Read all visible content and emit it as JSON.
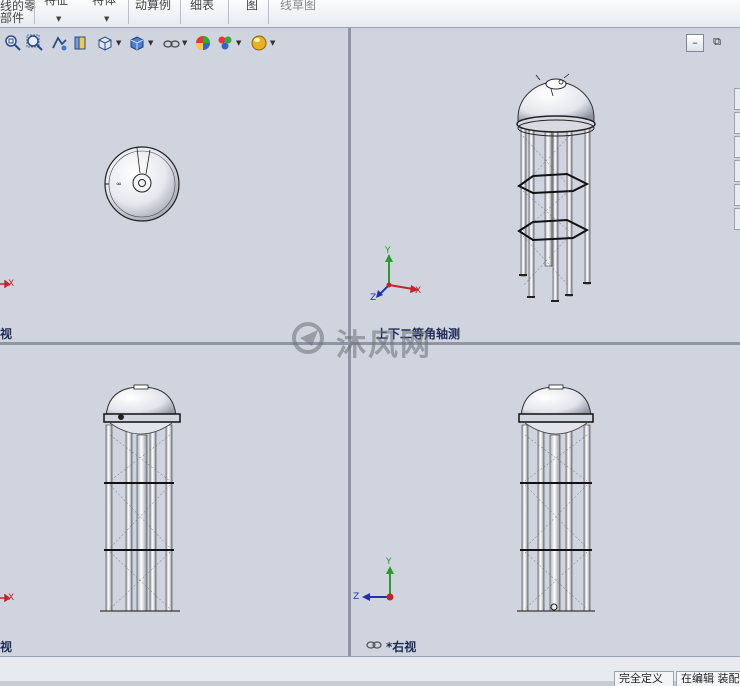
{
  "ribbon": {
    "items": [
      {
        "label_line1": "线的零",
        "label_line2": "部件"
      },
      {
        "label": "特征"
      },
      {
        "label": "特体"
      },
      {
        "label": "动算例"
      },
      {
        "label": "细表"
      },
      {
        "label": "图"
      },
      {
        "label": "线草图"
      }
    ]
  },
  "view_toolbar": {
    "icons": [
      "zoom-to-fit-icon",
      "zoom-to-area-icon",
      "previous-view-icon",
      "section-view-icon",
      "view-orientation-icon",
      "display-style-icon",
      "hide-show-items-icon",
      "edit-appearance-icon",
      "apply-scene-icon",
      "view-settings-icon"
    ]
  },
  "window_buttons": {
    "minimize": "–",
    "restore": "⧉"
  },
  "viewports": {
    "top_left": {
      "label": "视",
      "axis": "X"
    },
    "top_right": {
      "label": "上下二等角轴测",
      "axes": [
        "Y",
        "X",
        "Z"
      ]
    },
    "bottom_left": {
      "label": "视",
      "axis": "X"
    },
    "bottom_right": {
      "label": "*右视",
      "axes": [
        "Y",
        "Z"
      ]
    }
  },
  "watermark": {
    "text": "沐风网"
  },
  "statusbar": {
    "fields": [
      "完全定义",
      "在编辑 装配体"
    ]
  },
  "colors": {
    "background": "#cfd4de",
    "axis_x": "#c0262a",
    "axis_y": "#2a9a2a",
    "axis_z": "#2030b0",
    "label": "#1f2a55"
  }
}
